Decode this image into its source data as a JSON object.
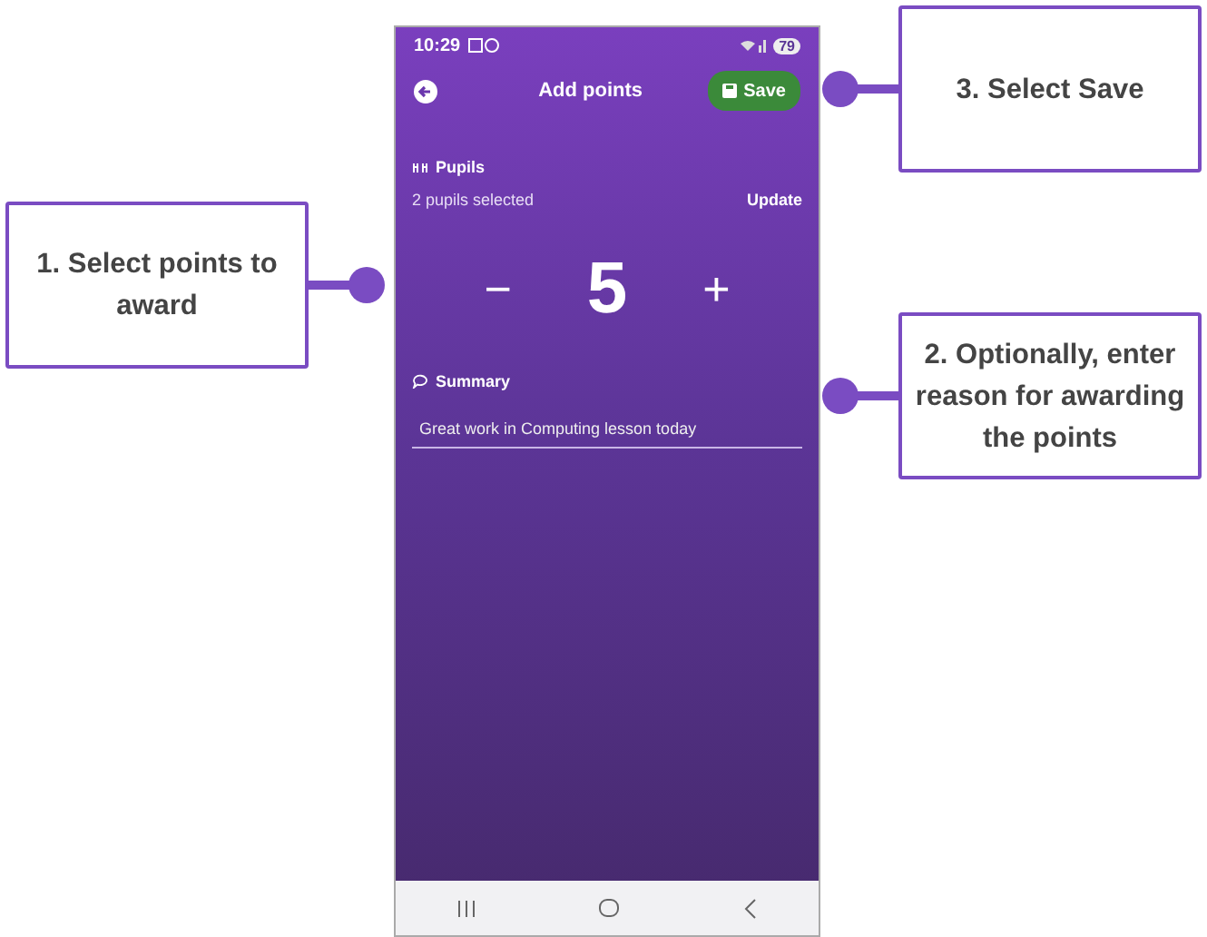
{
  "left_callouts": [
    {
      "text": "1. Select points to award"
    }
  ],
  "right_callouts": [
    {
      "text": "3. Select Save"
    },
    {
      "text": "2. Optionally, enter reason for awarding the points"
    }
  ],
  "phone": {
    "status_bar": {
      "time": "10:29",
      "battery": "79"
    },
    "header": {
      "title": "Add points",
      "save_label": "Save"
    },
    "pupils": {
      "label": "Pupils",
      "selected_text": "2 pupils selected",
      "action": "Update"
    },
    "points": {
      "minus": "−",
      "value": "5",
      "plus": "+"
    },
    "summary": {
      "label": "Summary",
      "value": "Great work in Computing lesson today"
    }
  }
}
